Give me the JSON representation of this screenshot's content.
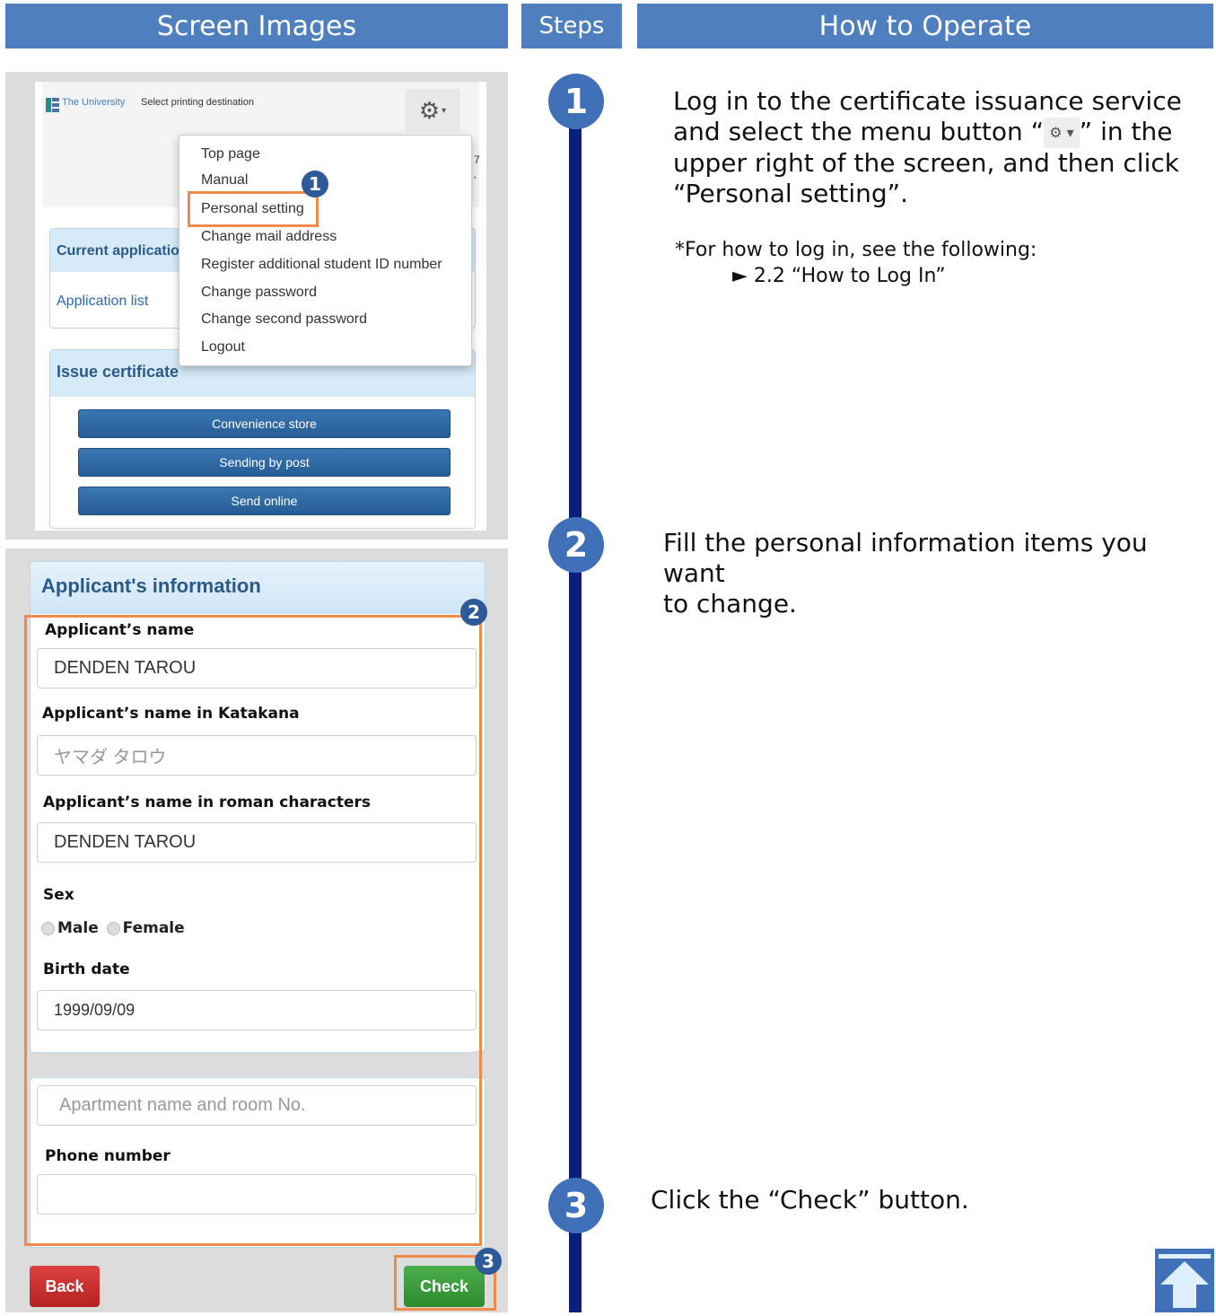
{
  "headers": {
    "screen_images": "Screen Images",
    "steps": "Steps",
    "how_to_operate": "How to Operate"
  },
  "shot1": {
    "brand": "The University",
    "page_title": "Select printing destination",
    "menu_items": [
      "Top page",
      "Manual",
      "Personal setting",
      "Change mail address",
      "Register additional student ID number",
      "Change password",
      "Change second password",
      "Logout"
    ],
    "current_application": "Current applicatio",
    "application_list": "Application list",
    "issue_certificate": "Issue certificate",
    "buttons": [
      "Convenience store",
      "Sending by post",
      "Send online"
    ],
    "edge_chars": [
      "7",
      "'"
    ]
  },
  "shot2": {
    "section_title": "Applicant's information",
    "name_label": "Applicant’s name",
    "name_value": "DENDEN TAROU",
    "katakana_label": "Applicant’s name in Katakana",
    "katakana_placeholder": "ヤマダ タロウ",
    "roman_label": "Applicant’s name in roman characters",
    "roman_value": "DENDEN TAROU",
    "sex_label": "Sex",
    "male": "Male",
    "female": "Female",
    "birth_label": "Birth date",
    "birth_value": "1999/09/09",
    "apartment_placeholder": "Apartment name and room No.",
    "phone_label": "Phone number",
    "phone_value": "",
    "back": "Back",
    "check": "Check"
  },
  "markers": [
    "1",
    "2",
    "3"
  ],
  "steps": {
    "step1_line1": "Log in to the certificate issuance service",
    "step1_line2a": "and select the menu button “",
    "step1_line2b": "” in the",
    "step1_line3": "upper right of the screen, and then click",
    "step1_line4": "“Personal setting”.",
    "note1": "*For how to log in, see the following:",
    "note2": "► 2.2 “How to Log In”",
    "step2_line1": "Fill the personal information items you want",
    "step2_line2": "to change.",
    "step3": "Click the “Check” button."
  },
  "colors": {
    "header": "#4f7fbf",
    "timeline": "#0a1f7a",
    "step_circle": "#3f70b8",
    "highlight": "#f08a4b",
    "check_button": "#3c9a3c",
    "back_button": "#c62b2b"
  }
}
